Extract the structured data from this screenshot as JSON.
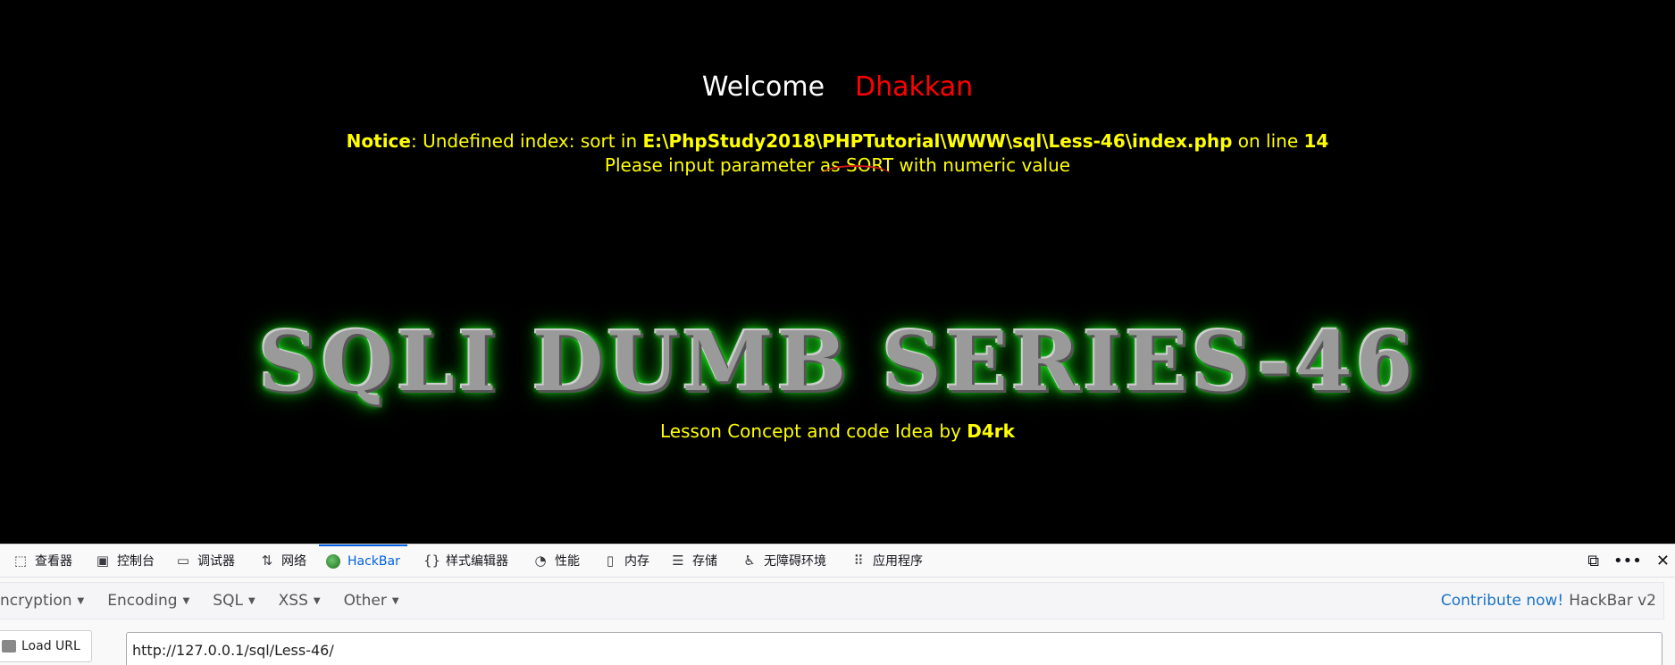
{
  "page": {
    "welcome": "Welcome",
    "user_name": "Dhakkan",
    "notice": {
      "label": "Notice",
      "text": ": Undefined index: sort in ",
      "path": "E:\\PhpStudy2018\\PHPTutorial\\WWW\\sql\\Less-46\\index.php",
      "on_line": " on line ",
      "line": "14"
    },
    "instruction": "Please input parameter as SORT with numeric value",
    "banner": "SQLI DUMB SERIES-46",
    "credit_prefix": "Lesson Concept and code Idea by ",
    "credit_author": "D4rk"
  },
  "devtools": {
    "tabs": [
      {
        "label": "查看器",
        "icon": "inspector-icon"
      },
      {
        "label": "控制台",
        "icon": "console-icon"
      },
      {
        "label": "调试器",
        "icon": "debugger-icon"
      },
      {
        "label": "网络",
        "icon": "network-icon"
      },
      {
        "label": "HackBar",
        "icon": "hackbar-icon",
        "active": true
      },
      {
        "label": "样式编辑器",
        "icon": "style-editor-icon"
      },
      {
        "label": "性能",
        "icon": "performance-icon"
      },
      {
        "label": "内存",
        "icon": "memory-icon"
      },
      {
        "label": "存储",
        "icon": "storage-icon"
      },
      {
        "label": "无障碍环境",
        "icon": "accessibility-icon"
      },
      {
        "label": "应用程序",
        "icon": "application-icon"
      }
    ]
  },
  "hackbar": {
    "menu": [
      "ncryption",
      "Encoding",
      "SQL",
      "XSS",
      "Other"
    ],
    "contribute": "Contribute now!",
    "version": "HackBar v2",
    "load_url": "Load URL",
    "url": "http://127.0.0.1/sql/Less-46/"
  },
  "colors": {
    "page_bg": "#000000",
    "welcome": "#ffffff",
    "user_name": "#ff0000",
    "notice_text": "#ffff00",
    "banner_glow": "#28ff28",
    "active_tab": "#0060df"
  }
}
